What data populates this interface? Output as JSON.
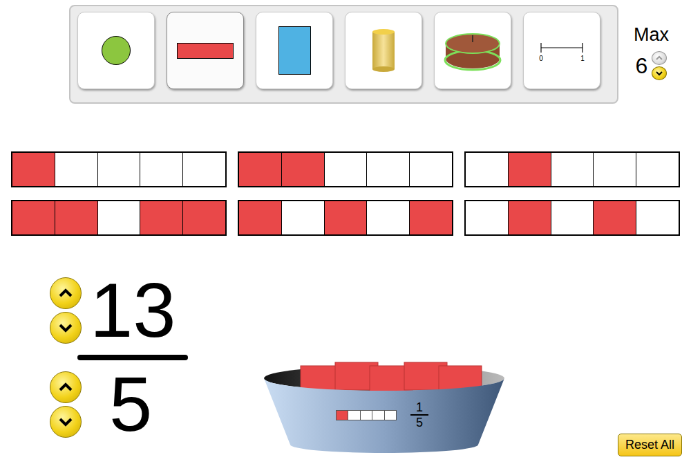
{
  "toolbar": {
    "representations": [
      {
        "kind": "circle",
        "selected": false
      },
      {
        "kind": "horizontal-bar",
        "selected": true
      },
      {
        "kind": "vertical-bar",
        "selected": false
      },
      {
        "kind": "cylinder",
        "selected": false
      },
      {
        "kind": "cake",
        "selected": false
      },
      {
        "kind": "number-line",
        "selected": false,
        "start": "0",
        "end": "1"
      }
    ]
  },
  "max": {
    "label": "Max",
    "value": "6",
    "up_disabled": true,
    "down_disabled": false
  },
  "containers": [
    {
      "cells": [
        true,
        false,
        false,
        false,
        false
      ]
    },
    {
      "cells": [
        true,
        true,
        false,
        false,
        false
      ]
    },
    {
      "cells": [
        false,
        true,
        false,
        false,
        false
      ]
    },
    {
      "cells": [
        true,
        true,
        false,
        true,
        true
      ]
    },
    {
      "cells": [
        true,
        false,
        true,
        false,
        true
      ]
    },
    {
      "cells": [
        false,
        true,
        false,
        true,
        false
      ]
    }
  ],
  "fraction": {
    "numerator": "13",
    "denominator": "5"
  },
  "bucket": {
    "pieces": 5,
    "cells": [
      true,
      false,
      false,
      false,
      false
    ],
    "numerator": "1",
    "denominator": "5"
  },
  "reset_button": "Reset All"
}
